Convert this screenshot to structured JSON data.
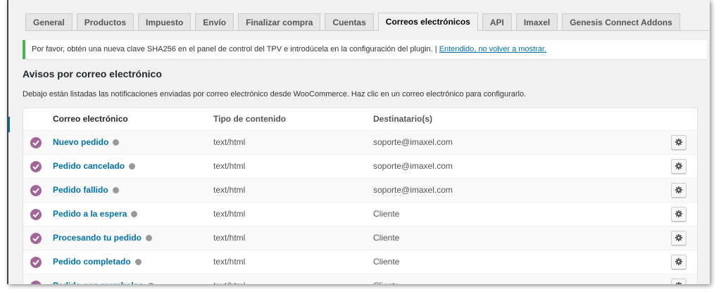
{
  "tabs": [
    {
      "label": "General",
      "active": false
    },
    {
      "label": "Productos",
      "active": false
    },
    {
      "label": "Impuesto",
      "active": false
    },
    {
      "label": "Envío",
      "active": false
    },
    {
      "label": "Finalizar compra",
      "active": false
    },
    {
      "label": "Cuentas",
      "active": false
    },
    {
      "label": "Correos electrónicos",
      "active": true
    },
    {
      "label": "API",
      "active": false
    },
    {
      "label": "Imaxel",
      "active": false
    },
    {
      "label": "Genesis Connect Addons",
      "active": false
    }
  ],
  "notice": {
    "text": "Por favor, obtén una nueva clave SHA256 en el panel de control del TPV e introdúcela en la configuración del plugin. |",
    "link": "Entendido, no volver a mostrar."
  },
  "section": {
    "title": "Avisos por correo electrónico",
    "description": "Debajo están listadas las notificaciones enviadas por correo electrónico desde WooCommerce. Haz clic en un correo electrónico para configurarlo."
  },
  "table": {
    "headers": {
      "email": "Correo electrónico",
      "content_type": "Tipo de contenido",
      "recipient": "Destinatario(s)"
    },
    "rows": [
      {
        "name": "Nuevo pedido",
        "type": "text/html",
        "recipient": "soporte@imaxel.com"
      },
      {
        "name": "Pedido cancelado",
        "type": "text/html",
        "recipient": "soporte@imaxel.com"
      },
      {
        "name": "Pedido fallido",
        "type": "text/html",
        "recipient": "soporte@imaxel.com"
      },
      {
        "name": "Pedido a la espera",
        "type": "text/html",
        "recipient": "Cliente"
      },
      {
        "name": "Procesando tu pedido",
        "type": "text/html",
        "recipient": "Cliente"
      },
      {
        "name": "Pedido completado",
        "type": "text/html",
        "recipient": "Cliente"
      },
      {
        "name": "Pedido con reembolso",
        "type": "text/html",
        "recipient": "Cliente"
      }
    ]
  },
  "icons": {
    "status": "check-circle-icon",
    "help": "help-icon",
    "action": "gear-icon"
  },
  "colors": {
    "accent": "#0073aa",
    "status_enabled": "#a36597",
    "notice_border": "#46b450"
  }
}
